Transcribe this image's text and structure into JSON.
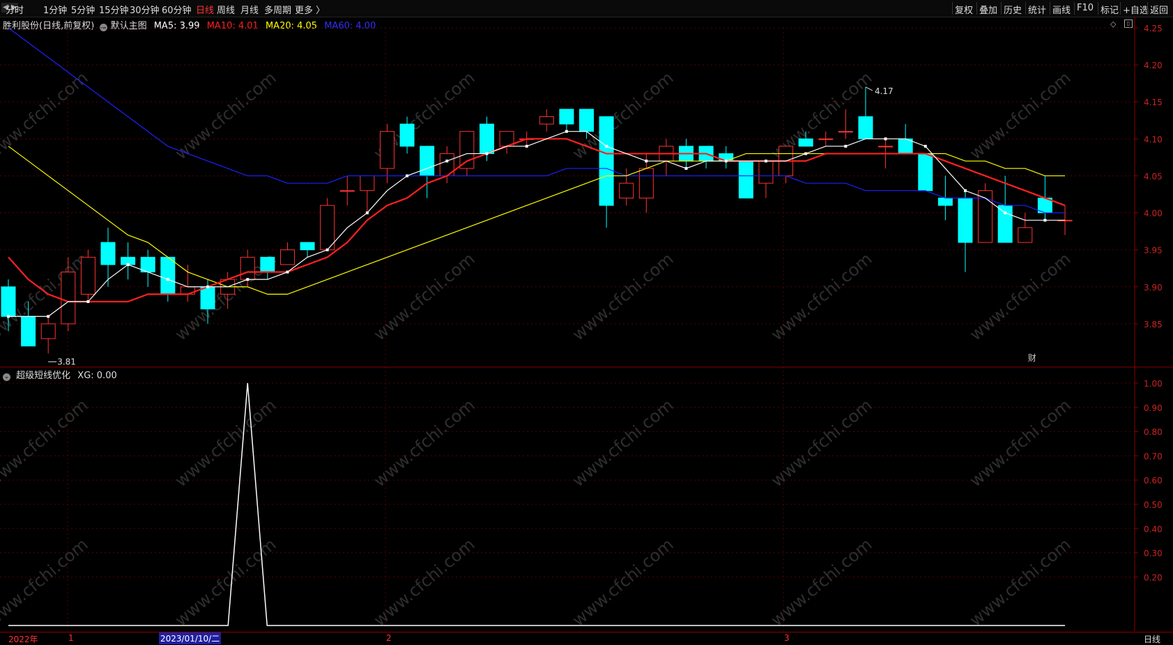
{
  "toolbar": {
    "periods": [
      "分时",
      "1分钟",
      "5分钟",
      "15分钟",
      "30分钟",
      "60分钟",
      "日线",
      "周线",
      "月线",
      "多周期",
      "更多 〉"
    ],
    "active_period": "日线",
    "right_items": [
      "复权",
      "叠加",
      "历史",
      "统计",
      "画线",
      "F10",
      "标记",
      "+自选",
      "返回"
    ]
  },
  "main_panel": {
    "title": "胜利股份(日线,前复权)",
    "indicator": "默认主图",
    "ma5": "MA5: 3.99",
    "ma10": "MA10: 4.01",
    "ma20": "MA20: 4.05",
    "ma60": "MA60: 4.00",
    "high_label": "4.17",
    "low_label": "3.81",
    "finance_marker": "财",
    "yaxis_ticks": [
      "4.25",
      "4.20",
      "4.15",
      "4.10",
      "4.05",
      "4.00",
      "3.95",
      "3.90",
      "3.85"
    ]
  },
  "sub_panel": {
    "title": "超级短线优化",
    "xg": "XG: 0.00",
    "yaxis_ticks": [
      "1.00",
      "0.90",
      "0.80",
      "0.70",
      "0.60",
      "0.50",
      "0.40",
      "0.30",
      "0.20"
    ]
  },
  "bottom": {
    "year": "2022年",
    "months": [
      "1",
      "2",
      "3"
    ],
    "cursor_date": "2023/01/10/二",
    "period": "日线"
  },
  "watermark": "www.cfchi.com",
  "colors": {
    "up": "#ff3333",
    "down": "#00ffff",
    "ma5": "#ffffff",
    "ma10": "#ff2020",
    "ma20": "#ffff00",
    "ma60": "#2020ff",
    "axis": "#8b0000"
  },
  "chart_data": {
    "type": "candlestick",
    "candles": [
      {
        "o": 3.9,
        "c": 3.86,
        "h": 3.91,
        "l": 3.84
      },
      {
        "o": 3.86,
        "c": 3.82,
        "h": 3.88,
        "l": 3.82
      },
      {
        "o": 3.83,
        "c": 3.85,
        "h": 3.86,
        "l": 3.81
      },
      {
        "o": 3.85,
        "c": 3.92,
        "h": 3.94,
        "l": 3.84
      },
      {
        "o": 3.89,
        "c": 3.94,
        "h": 3.95,
        "l": 3.88
      },
      {
        "o": 3.96,
        "c": 3.93,
        "h": 3.98,
        "l": 3.9
      },
      {
        "o": 3.94,
        "c": 3.93,
        "h": 3.96,
        "l": 3.91
      },
      {
        "o": 3.94,
        "c": 3.92,
        "h": 3.95,
        "l": 3.9
      },
      {
        "o": 3.94,
        "c": 3.89,
        "h": 3.94,
        "l": 3.88
      },
      {
        "o": 3.89,
        "c": 3.9,
        "h": 3.93,
        "l": 3.88
      },
      {
        "o": 3.9,
        "c": 3.87,
        "h": 3.91,
        "l": 3.85
      },
      {
        "o": 3.89,
        "c": 3.91,
        "h": 3.92,
        "l": 3.87
      },
      {
        "o": 3.91,
        "c": 3.94,
        "h": 3.95,
        "l": 3.9
      },
      {
        "o": 3.94,
        "c": 3.92,
        "h": 3.94,
        "l": 3.91
      },
      {
        "o": 3.93,
        "c": 3.95,
        "h": 3.96,
        "l": 3.93
      },
      {
        "o": 3.96,
        "c": 3.95,
        "h": 3.96,
        "l": 3.94
      },
      {
        "o": 3.95,
        "c": 4.01,
        "h": 4.02,
        "l": 3.95
      },
      {
        "o": 4.03,
        "c": 4.03,
        "h": 4.05,
        "l": 4.01
      },
      {
        "o": 4.03,
        "c": 4.05,
        "h": 4.05,
        "l": 4.0
      },
      {
        "o": 4.06,
        "c": 4.11,
        "h": 4.12,
        "l": 4.04
      },
      {
        "o": 4.12,
        "c": 4.09,
        "h": 4.13,
        "l": 4.08
      },
      {
        "o": 4.09,
        "c": 4.05,
        "h": 4.09,
        "l": 4.02
      },
      {
        "o": 4.05,
        "c": 4.08,
        "h": 4.09,
        "l": 4.04
      },
      {
        "o": 4.06,
        "c": 4.11,
        "h": 4.11,
        "l": 4.05
      },
      {
        "o": 4.12,
        "c": 4.08,
        "h": 4.13,
        "l": 4.07
      },
      {
        "o": 4.09,
        "c": 4.11,
        "h": 4.11,
        "l": 4.08
      },
      {
        "o": 4.1,
        "c": 4.1,
        "h": 4.11,
        "l": 4.09
      },
      {
        "o": 4.12,
        "c": 4.13,
        "h": 4.14,
        "l": 4.11
      },
      {
        "o": 4.14,
        "c": 4.12,
        "h": 4.14,
        "l": 4.11
      },
      {
        "o": 4.14,
        "c": 4.11,
        "h": 4.14,
        "l": 4.1
      },
      {
        "o": 4.13,
        "c": 4.01,
        "h": 4.13,
        "l": 3.98
      },
      {
        "o": 4.02,
        "c": 4.04,
        "h": 4.06,
        "l": 4.01
      },
      {
        "o": 4.02,
        "c": 4.06,
        "h": 4.08,
        "l": 4.0
      },
      {
        "o": 4.07,
        "c": 4.09,
        "h": 4.1,
        "l": 4.05
      },
      {
        "o": 4.09,
        "c": 4.07,
        "h": 4.1,
        "l": 4.06
      },
      {
        "o": 4.09,
        "c": 4.07,
        "h": 4.09,
        "l": 4.06
      },
      {
        "o": 4.08,
        "c": 4.07,
        "h": 4.09,
        "l": 4.06
      },
      {
        "o": 4.07,
        "c": 4.02,
        "h": 4.07,
        "l": 4.02
      },
      {
        "o": 4.04,
        "c": 4.07,
        "h": 4.07,
        "l": 4.02
      },
      {
        "o": 4.05,
        "c": 4.09,
        "h": 4.09,
        "l": 4.04
      },
      {
        "o": 4.1,
        "c": 4.09,
        "h": 4.11,
        "l": 4.09
      },
      {
        "o": 4.1,
        "c": 4.1,
        "h": 4.11,
        "l": 4.09
      },
      {
        "o": 4.11,
        "c": 4.11,
        "h": 4.14,
        "l": 4.1
      },
      {
        "o": 4.13,
        "c": 4.1,
        "h": 4.17,
        "l": 4.1
      },
      {
        "o": 4.09,
        "c": 4.09,
        "h": 4.1,
        "l": 4.06
      },
      {
        "o": 4.1,
        "c": 4.08,
        "h": 4.12,
        "l": 4.08
      },
      {
        "o": 4.08,
        "c": 4.03,
        "h": 4.08,
        "l": 4.03
      },
      {
        "o": 4.02,
        "c": 4.01,
        "h": 4.05,
        "l": 3.99
      },
      {
        "o": 4.02,
        "c": 3.96,
        "h": 4.03,
        "l": 3.92
      },
      {
        "o": 3.96,
        "c": 4.03,
        "h": 4.04,
        "l": 3.96
      },
      {
        "o": 4.01,
        "c": 3.96,
        "h": 4.05,
        "l": 3.96
      },
      {
        "o": 3.96,
        "c": 3.98,
        "h": 4.0,
        "l": 3.96
      },
      {
        "o": 4.02,
        "c": 4.0,
        "h": 4.05,
        "l": 3.99
      },
      {
        "o": 3.99,
        "c": 3.99,
        "h": 4.01,
        "l": 3.97
      }
    ],
    "ma5": [
      3.86,
      3.86,
      3.86,
      3.88,
      3.88,
      3.91,
      3.93,
      3.92,
      3.91,
      3.9,
      3.9,
      3.9,
      3.91,
      3.91,
      3.92,
      3.94,
      3.95,
      3.98,
      4.0,
      4.03,
      4.05,
      4.06,
      4.07,
      4.08,
      4.08,
      4.09,
      4.09,
      4.1,
      4.11,
      4.11,
      4.09,
      4.08,
      4.07,
      4.07,
      4.06,
      4.07,
      4.07,
      4.07,
      4.07,
      4.07,
      4.08,
      4.09,
      4.09,
      4.1,
      4.1,
      4.1,
      4.09,
      4.06,
      4.03,
      4.02,
      4.0,
      3.99,
      3.99,
      3.99
    ],
    "ma10": [
      3.94,
      3.91,
      3.89,
      3.88,
      3.88,
      3.88,
      3.88,
      3.89,
      3.89,
      3.89,
      3.9,
      3.91,
      3.92,
      3.92,
      3.92,
      3.93,
      3.94,
      3.96,
      3.99,
      4.01,
      4.02,
      4.04,
      4.05,
      4.07,
      4.08,
      4.09,
      4.1,
      4.1,
      4.1,
      4.09,
      4.08,
      4.08,
      4.08,
      4.08,
      4.08,
      4.08,
      4.07,
      4.07,
      4.07,
      4.07,
      4.07,
      4.08,
      4.08,
      4.08,
      4.08,
      4.08,
      4.08,
      4.07,
      4.06,
      4.05,
      4.04,
      4.03,
      4.02,
      4.01
    ],
    "ma20": [
      4.09,
      4.07,
      4.05,
      4.03,
      4.01,
      3.99,
      3.97,
      3.96,
      3.94,
      3.92,
      3.91,
      3.9,
      3.9,
      3.89,
      3.89,
      3.9,
      3.91,
      3.92,
      3.93,
      3.94,
      3.95,
      3.96,
      3.97,
      3.98,
      3.99,
      4.0,
      4.01,
      4.02,
      4.03,
      4.04,
      4.05,
      4.05,
      4.06,
      4.07,
      4.07,
      4.07,
      4.07,
      4.08,
      4.08,
      4.08,
      4.08,
      4.08,
      4.08,
      4.08,
      4.08,
      4.08,
      4.08,
      4.08,
      4.07,
      4.07,
      4.06,
      4.06,
      4.05,
      4.05
    ],
    "ma60": [
      4.25,
      4.23,
      4.21,
      4.19,
      4.17,
      4.15,
      4.13,
      4.11,
      4.09,
      4.08,
      4.07,
      4.06,
      4.05,
      4.05,
      4.04,
      4.04,
      4.04,
      4.05,
      4.05,
      4.05,
      4.05,
      4.05,
      4.05,
      4.05,
      4.05,
      4.05,
      4.05,
      4.05,
      4.06,
      4.06,
      4.06,
      4.05,
      4.05,
      4.05,
      4.05,
      4.05,
      4.05,
      4.05,
      4.05,
      4.05,
      4.04,
      4.04,
      4.04,
      4.03,
      4.03,
      4.03,
      4.03,
      4.02,
      4.02,
      4.02,
      4.01,
      4.01,
      4.0,
      4.0
    ],
    "main_ylim": [
      3.8,
      4.25
    ],
    "xg_series": [
      0,
      0,
      0,
      0,
      0,
      0,
      0,
      0,
      0,
      0,
      0,
      0,
      1,
      0,
      0,
      0,
      0,
      0,
      0,
      0,
      0,
      0,
      0,
      0,
      0,
      0,
      0,
      0,
      0,
      0,
      0,
      0,
      0,
      0,
      0,
      0,
      0,
      0,
      0,
      0,
      0,
      0,
      0,
      0,
      0,
      0,
      0,
      0,
      0,
      0,
      0,
      0,
      0,
      0
    ],
    "sub_ylim": [
      0,
      1.0
    ]
  }
}
